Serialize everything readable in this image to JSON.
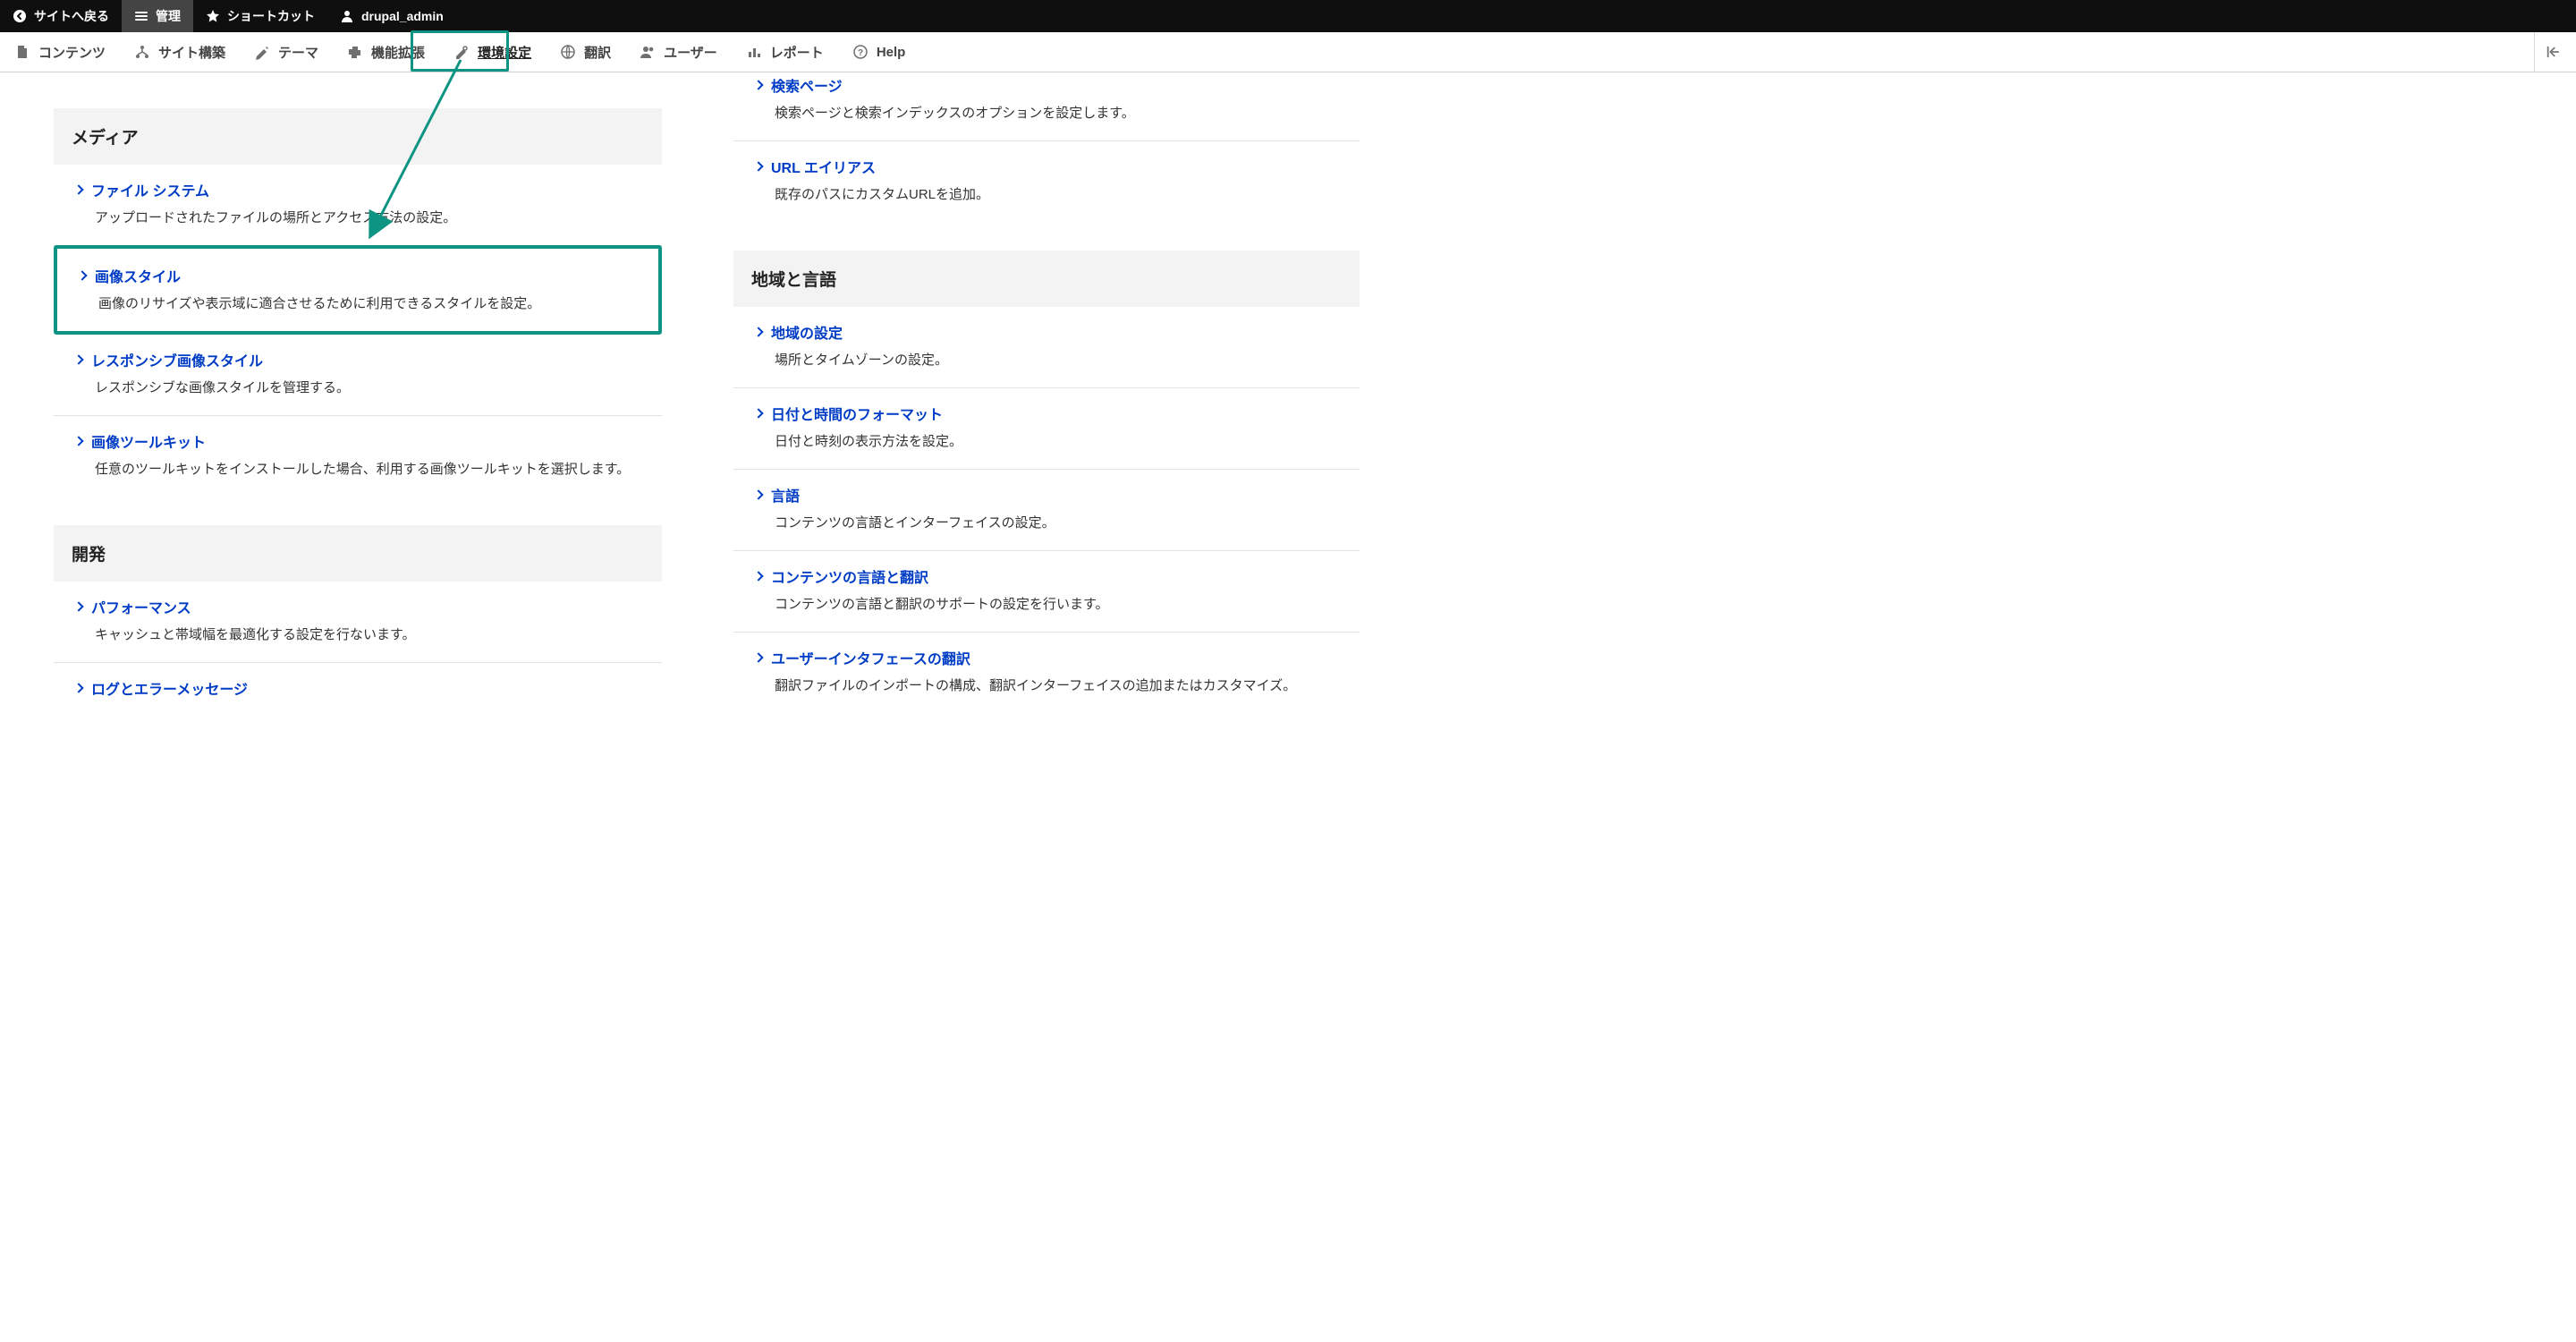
{
  "toolbar": {
    "back": "サイトへ戻る",
    "manage": "管理",
    "shortcuts": "ショートカット",
    "user": "drupal_admin"
  },
  "admin_menu": {
    "items": [
      {
        "label": "コンテンツ",
        "icon": "content"
      },
      {
        "label": "サイト構築",
        "icon": "structure"
      },
      {
        "label": "テーマ",
        "icon": "appearance"
      },
      {
        "label": "機能拡張",
        "icon": "extend"
      },
      {
        "label": "環境設定",
        "icon": "config"
      },
      {
        "label": "翻訳",
        "icon": "translate"
      },
      {
        "label": "ユーザー",
        "icon": "people"
      },
      {
        "label": "レポート",
        "icon": "reports"
      },
      {
        "label": "Help",
        "icon": "help"
      }
    ]
  },
  "left": {
    "media_header": "メディア",
    "items": [
      {
        "title": "ファイル システム",
        "desc": "アップロードされたファイルの場所とアクセス方法の設定。"
      },
      {
        "title": "画像スタイル",
        "desc": "画像のリサイズや表示域に適合させるために利用できるスタイルを設定。"
      },
      {
        "title": "レスポンシブ画像スタイル",
        "desc": "レスポンシブな画像スタイルを管理する。"
      },
      {
        "title": "画像ツールキット",
        "desc": "任意のツールキットをインストールした場合、利用する画像ツールキットを選択します。"
      }
    ],
    "dev_header": "開発",
    "dev_items": [
      {
        "title": "パフォーマンス",
        "desc": "キャッシュと帯域幅を最適化する設定を行ないます。"
      },
      {
        "title": "ログとエラーメッセージ",
        "desc": ""
      }
    ]
  },
  "right": {
    "search_items": [
      {
        "title": "検索ページ",
        "desc": "検索ページと検索インデックスのオプションを設定します。"
      },
      {
        "title": "URL エイリアス",
        "desc": "既存のパスにカスタムURLを追加。"
      }
    ],
    "region_header": "地域と言語",
    "region_items": [
      {
        "title": "地域の設定",
        "desc": "場所とタイムゾーンの設定。"
      },
      {
        "title": "日付と時間のフォーマット",
        "desc": "日付と時刻の表示方法を設定。"
      },
      {
        "title": "言語",
        "desc": "コンテンツの言語とインターフェイスの設定。"
      },
      {
        "title": "コンテンツの言語と翻訳",
        "desc": "コンテンツの言語と翻訳のサポートの設定を行います。"
      },
      {
        "title": "ユーザーインタフェースの翻訳",
        "desc": "翻訳ファイルのインポートの構成、翻訳インターフェイスの追加またはカスタマイズ。"
      }
    ]
  },
  "colors": {
    "link": "#003cc5",
    "highlight": "#0d9482"
  }
}
